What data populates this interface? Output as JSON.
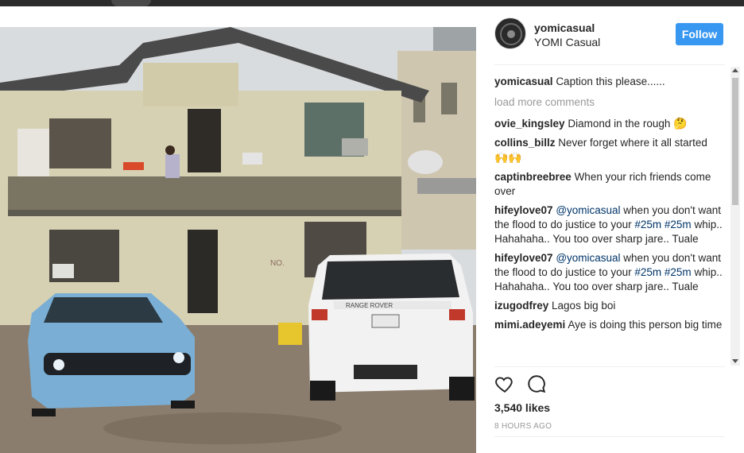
{
  "post": {
    "username": "yomicasual",
    "full_name": "YOMI Casual",
    "follow_label": "Follow",
    "image_texts": {
      "plate_brand": "RANGE ROVER",
      "wall_text": "NO."
    }
  },
  "comments": [
    {
      "user": "yomicasual",
      "parts": [
        {
          "t": "text",
          "v": "Caption this please......"
        }
      ]
    },
    {
      "type": "load_more",
      "label": "load more comments"
    },
    {
      "user": "ovie_kingsley",
      "parts": [
        {
          "t": "text",
          "v": "Diamond in the rough "
        },
        {
          "t": "emoji",
          "v": "🤔"
        }
      ]
    },
    {
      "user": "collins_billz",
      "parts": [
        {
          "t": "text",
          "v": "Never forget where it all started "
        },
        {
          "t": "emoji",
          "v": "🙌🙌"
        }
      ]
    },
    {
      "user": "captinbreebree",
      "parts": [
        {
          "t": "text",
          "v": "When your rich friends come over"
        }
      ]
    },
    {
      "user": "hifeylove07",
      "parts": [
        {
          "t": "mention",
          "v": "@yomicasual"
        },
        {
          "t": "text",
          "v": " when you don't want the flood to do justice to your "
        },
        {
          "t": "mention",
          "v": "#25m"
        },
        {
          "t": "text",
          "v": " "
        },
        {
          "t": "mention",
          "v": "#25m"
        },
        {
          "t": "text",
          "v": " whip.. Hahahaha.. You too over sharp jare.. Tuale"
        }
      ]
    },
    {
      "user": "hifeylove07",
      "parts": [
        {
          "t": "mention",
          "v": "@yomicasual"
        },
        {
          "t": "text",
          "v": " when you don't want the flood to do justice to your "
        },
        {
          "t": "mention",
          "v": "#25m"
        },
        {
          "t": "text",
          "v": " "
        },
        {
          "t": "mention",
          "v": "#25m"
        },
        {
          "t": "text",
          "v": " whip.. Hahahaha.. You too over sharp jare.. Tuale"
        }
      ]
    },
    {
      "user": "izugodfrey",
      "parts": [
        {
          "t": "text",
          "v": "Lagos big boi"
        }
      ]
    },
    {
      "user": "mimi.adeyemi",
      "parts": [
        {
          "t": "text",
          "v": "Aye is doing this person big time"
        }
      ]
    }
  ],
  "likes_label": "3,540 likes",
  "time_label": "8 HOURS AGO",
  "icons": {
    "like": "heart-icon",
    "comment": "comment-icon"
  },
  "colors": {
    "accent": "#3897f0",
    "mention": "#003569",
    "muted": "#999999"
  }
}
